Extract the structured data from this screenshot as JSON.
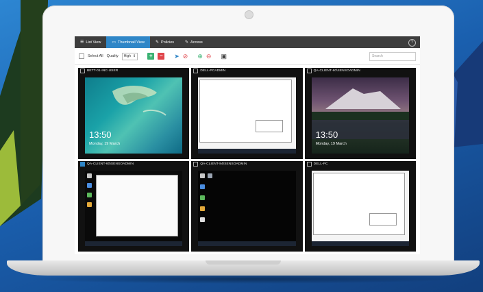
{
  "tabs": [
    {
      "icon": "list-icon",
      "label": "List View",
      "active": false
    },
    {
      "icon": "monitor-icon",
      "label": "Thumbnail View",
      "active": true
    },
    {
      "icon": "wrench-icon",
      "label": "Policies",
      "active": false
    },
    {
      "icon": "wrench-icon",
      "label": "Access",
      "active": false
    }
  ],
  "toolbar": {
    "select_all_label": "Select All",
    "quality_label": "Quality",
    "quality_value": "High",
    "search_placeholder": "Search"
  },
  "tiles": [
    {
      "title": "BETT-01-INC-USER",
      "checked": false,
      "kind": "lock",
      "time": "13:50",
      "date": "Monday, 19 March",
      "scene": "reef"
    },
    {
      "title": "DELL-PCADMIN",
      "checked": false,
      "kind": "desktop-white"
    },
    {
      "title": "QA-CLIENT-60\\SENSOADMIN",
      "checked": false,
      "kind": "lock",
      "time": "13:50",
      "date": "Monday, 19 March",
      "scene": "mountain"
    },
    {
      "title": "QA-CLIENT-60\\SENSOADMIN",
      "checked": true,
      "kind": "desktop-explorer"
    },
    {
      "title": "QA-CLIENT-84\\SENSOADMIN",
      "checked": false,
      "kind": "desktop-black"
    },
    {
      "title": "DELL-PC",
      "checked": false,
      "kind": "desktop-white"
    }
  ],
  "colors": {
    "accent": "#2f86c7",
    "tabbar": "#3d3d3d",
    "add": "#3bb273",
    "remove": "#e0454b"
  }
}
